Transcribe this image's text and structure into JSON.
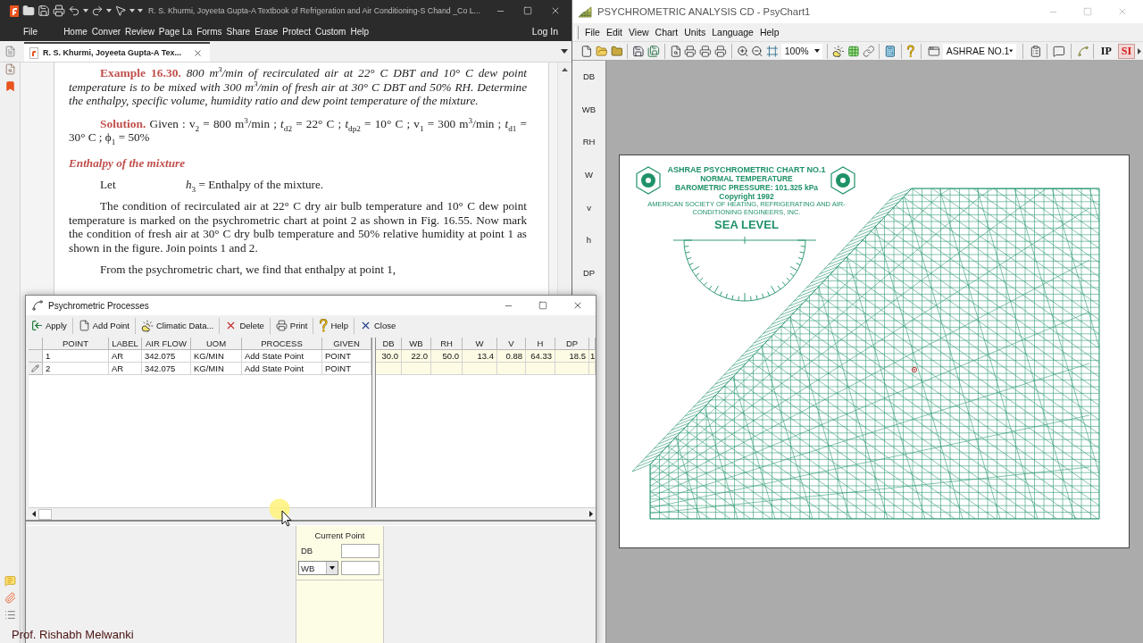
{
  "pdf_window": {
    "title": "R. S. Khurmi, Joyeeta Gupta-A Textbook of Refrigeration and Air Conditioning-S Chand _Co L...",
    "menu": [
      "File",
      "Home",
      "Conver",
      "Review",
      "Page La",
      "Forms",
      "Share",
      "Erase",
      "Protect",
      "Custom",
      "Help"
    ],
    "account": "Log In",
    "tabs": [
      {
        "label": "R. S. Khurmi, Joyeeta Gupta-A Tex...",
        "selected": true
      }
    ],
    "document": {
      "example": {
        "label": "Example 16.30.",
        "text": "800 m$^{3}$/min of recirculated air at 22° C DBT and 10° C dew point temperature is to be mixed with 300 m$^{3}$/min of fresh air at 30° C DBT and 50% RH. Determine the enthalpy, specific volume, humidity ratio and dew point temperature of the mixture."
      },
      "solution": {
        "label": "Solution.",
        "text": "Given : v$_{2}$ = 800 m$^{3}$/min ; *t*$_{d2}$ = 22° C ; *t*$_{dp2}$ = 10° C ; v$_{1}$ = 300 m$^{3}$/min ; *t*$_{d1}$ = 30° C ; ϕ$_{1}$ = 50%"
      },
      "heading": "Enthalpy of the mixture",
      "definition": {
        "term": "Let",
        "text": "*h*$_{3}$ = Enthalpy of the mixture."
      },
      "paragraphs": [
        "The condition of recirculated air at 22° C dry air bulb temperature and 10° C dew point temperature is marked on the psychrometric chart at point 2 as shown in Fig. 16.55. Now mark the condition of fresh air at 30° C dry bulb temperature and 50% relative humidity at point 1 as shown in the figure. Join points 1 and 2.",
        "From the psychrometric chart, we find that enthalpy at point 1,"
      ]
    }
  },
  "psychart_window": {
    "title": "PSYCHROMETRIC ANALYSIS CD - PsyChart1",
    "menu": [
      "File",
      "Edit",
      "View",
      "Chart",
      "Units",
      "Language",
      "Help"
    ],
    "zoom": "100%",
    "chart_name": "ASHRAE NO.1",
    "unit_systems": [
      {
        "label": "IP",
        "selected": false
      },
      {
        "label": "SI",
        "selected": true
      }
    ],
    "properties": [
      "DB",
      "WB",
      "RH",
      "W",
      "v",
      "h",
      "DP"
    ],
    "chart": {
      "title": "ASHRAE PSYCHROMETRIC CHART NO.1",
      "subtitle": "NORMAL TEMPERATURE",
      "pressure": "BAROMETRIC PRESSURE: 101.325 kPa",
      "copyright": "Copyright 1992",
      "publisher": "AMERICAN SOCIETY OF HEATING, REFRIGERATING AND AIR-CONDITIONING ENGINEERS, INC.",
      "elevation": "SEA LEVEL"
    }
  },
  "processes_dialog": {
    "title": "Psychrometric Processes",
    "toolbar": [
      {
        "kind": "apply",
        "label": "Apply"
      },
      {
        "kind": "add",
        "label": "Add Point"
      },
      {
        "kind": "climate",
        "label": "Climatic Data..."
      },
      {
        "kind": "delete",
        "label": "Delete"
      },
      {
        "kind": "print",
        "label": "Print"
      },
      {
        "kind": "help",
        "label": "Help"
      },
      {
        "kind": "close",
        "label": "Close"
      }
    ],
    "columns": [
      "POINT",
      "LABEL",
      "AIR FLOW",
      "UOM",
      "PROCESS",
      "GIVEN"
    ],
    "state_columns": [
      "DB",
      "WB",
      "RH",
      "W",
      "V",
      "H",
      "DP"
    ],
    "rows": [
      {
        "editing": false,
        "cells": [
          "1",
          "AR",
          "342.075",
          "KG/MIN",
          "Add State Point",
          "POINT"
        ],
        "state_values": [
          "30.0",
          "22.0",
          "50.0",
          "13.4",
          "0.88",
          "64.33",
          "18.5"
        ],
        "overflow_value": "1"
      },
      {
        "editing": true,
        "cells": [
          "2",
          "AR",
          "342.075",
          "KG/MIN",
          "Add State Point",
          "POINT"
        ]
      }
    ],
    "current_point": {
      "title": "Current Point",
      "fields": [
        {
          "kind": "label",
          "label": "DB"
        },
        {
          "kind": "select",
          "value": "WB"
        }
      ]
    }
  },
  "caption": "Prof. Rishabh Melwanki"
}
